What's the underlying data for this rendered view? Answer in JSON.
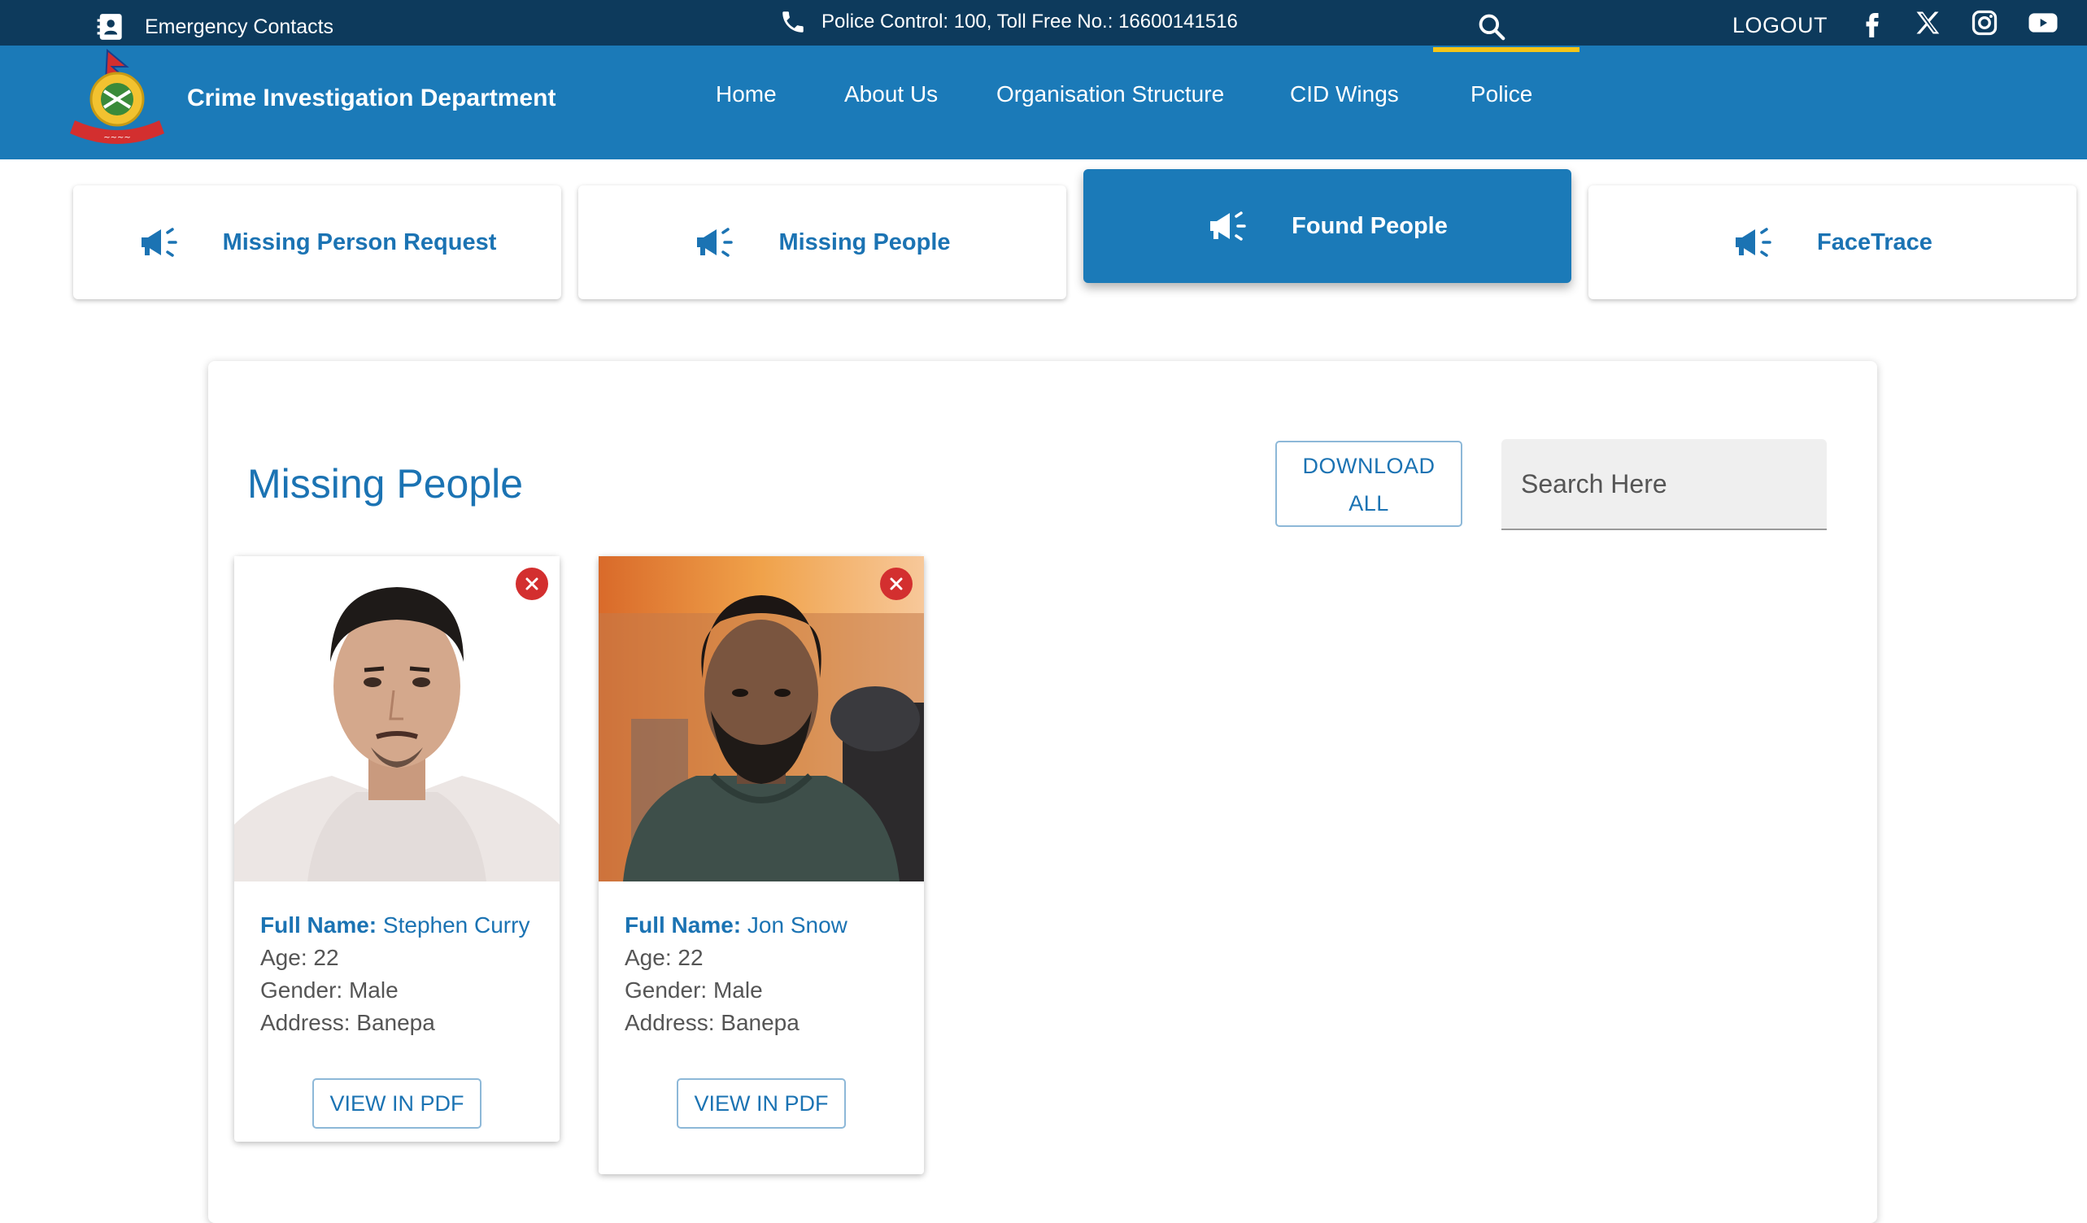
{
  "topbar": {
    "emergency_label": "Emergency Contacts",
    "phone_text": "Police Control: 100, Toll Free No.: 16600141516",
    "logout_label": "LOGOUT"
  },
  "header": {
    "department": "Crime Investigation Department",
    "nav": [
      "Home",
      "About Us",
      "Organisation Structure",
      "CID Wings",
      "Police"
    ]
  },
  "tabs": [
    {
      "label": "Missing Person Request",
      "active": false
    },
    {
      "label": "Missing People",
      "active": false
    },
    {
      "label": "Found People",
      "active": true
    },
    {
      "label": "FaceTrace",
      "active": false
    }
  ],
  "panel": {
    "title": "Missing People",
    "download_line1": "DOWNLOAD",
    "download_line2": "ALL",
    "search_placeholder": "Search Here"
  },
  "cards": [
    {
      "full_name_label": "Full Name:",
      "full_name": "Stephen Curry",
      "age": "Age: 22",
      "gender": "Gender: Male",
      "address": "Address: Banepa",
      "button": "VIEW IN PDF"
    },
    {
      "full_name_label": "Full Name:",
      "full_name": "Jon Snow",
      "age": "Age: 22",
      "gender": "Gender: Male",
      "address": "Address: Banepa",
      "button": "VIEW IN PDF"
    }
  ],
  "icons": {
    "emergency": "contact-book-icon",
    "phone": "phone-icon",
    "search": "search-icon",
    "social": [
      "facebook-icon",
      "x-icon",
      "instagram-icon",
      "youtube-icon"
    ],
    "tab": "megaphone-icon",
    "remove": "close-icon"
  },
  "colors": {
    "topbar": "#0d3a5c",
    "header": "#1b7ab8",
    "accent": "#1b73b3",
    "underline": "#f5c518",
    "remove": "#d32f2f"
  }
}
